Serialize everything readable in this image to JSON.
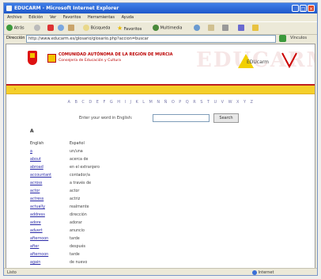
{
  "window": {
    "title": "EDUCARM - Microsoft Internet Explorer"
  },
  "menu": [
    "Archivo",
    "Edición",
    "Ver",
    "Favoritos",
    "Herramientas",
    "Ayuda"
  ],
  "toolbar": {
    "back_label": "Atrás",
    "search_label": "Búsqueda",
    "favorites_label": "Favoritos",
    "multimedia_label": "Multimedia"
  },
  "address": {
    "label": "Dirección",
    "url": "http://www.educarm.es/glosario/glosario.php?accion=buscar",
    "links_label": "Vínculos"
  },
  "header": {
    "org_title": "COMUNIDAD AUTÓNOMA DE LA REGIÓN DE MURCIA",
    "org_subtitle": "Consejería de Educación y Cultura",
    "watermark": "EDUCARM",
    "logo_text": "EDUcarm"
  },
  "yellow_bar": {
    "text": "›"
  },
  "alphabet": [
    "A",
    "B",
    "C",
    "D",
    "E",
    "F",
    "G",
    "H",
    "I",
    "J",
    "K",
    "L",
    "M",
    "N",
    "Ñ",
    "O",
    "P",
    "Q",
    "R",
    "S",
    "T",
    "U",
    "V",
    "W",
    "X",
    "Y",
    "Z"
  ],
  "search": {
    "label": "Enter your word in English:",
    "value": "",
    "button": "Search"
  },
  "letter_heading": "A",
  "columns": {
    "english": "English",
    "spanish": "Español"
  },
  "entries": [
    {
      "en": "a",
      "es": "un/una"
    },
    {
      "en": "about",
      "es": "acerca de"
    },
    {
      "en": "abroad",
      "es": "en el extranjero"
    },
    {
      "en": "accountant",
      "es": "contador/a"
    },
    {
      "en": "across",
      "es": "a través de"
    },
    {
      "en": "actor",
      "es": "actor"
    },
    {
      "en": "actress",
      "es": "actriz"
    },
    {
      "en": "actually",
      "es": "realmente"
    },
    {
      "en": "address",
      "es": "dirección"
    },
    {
      "en": "adore",
      "es": "adorar"
    },
    {
      "en": "advert",
      "es": "anuncio"
    },
    {
      "en": "afternoon",
      "es": "tarde"
    },
    {
      "en": "after",
      "es": "después"
    },
    {
      "en": "afternoon",
      "es": "tarde"
    },
    {
      "en": "again",
      "es": "de nuevo"
    }
  ],
  "status": {
    "left": "Listo",
    "right": "Internet"
  },
  "colors": {
    "titlebar": "#2a62d4",
    "header_red": "#c02020",
    "yellow_bar": "#f4cf2a",
    "link": "#2a2aa8"
  }
}
